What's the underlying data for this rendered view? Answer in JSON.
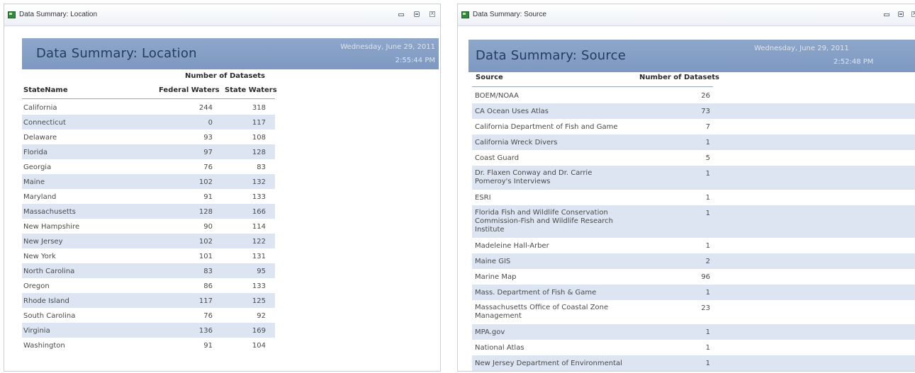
{
  "location_window": {
    "title": "Data Summary: Location",
    "report_title": "Data Summary: Location",
    "date": "Wednesday, June 29, 2011",
    "time": "2:55:44 PM",
    "group_header": "Number of Datasets",
    "columns": [
      "StateName",
      "Federal Waters",
      "State Waters"
    ],
    "rows": [
      {
        "state": "California",
        "federal": "244",
        "state_waters": "318"
      },
      {
        "state": "Connecticut",
        "federal": "0",
        "state_waters": "117"
      },
      {
        "state": "Delaware",
        "federal": "93",
        "state_waters": "108"
      },
      {
        "state": "Florida",
        "federal": "97",
        "state_waters": "128"
      },
      {
        "state": "Georgia",
        "federal": "76",
        "state_waters": "83"
      },
      {
        "state": "Maine",
        "federal": "102",
        "state_waters": "132"
      },
      {
        "state": "Maryland",
        "federal": "91",
        "state_waters": "133"
      },
      {
        "state": "Massachusetts",
        "federal": "128",
        "state_waters": "166"
      },
      {
        "state": "New Hampshire",
        "federal": "90",
        "state_waters": "114"
      },
      {
        "state": "New Jersey",
        "federal": "102",
        "state_waters": "122"
      },
      {
        "state": "New York",
        "federal": "101",
        "state_waters": "131"
      },
      {
        "state": "North Carolina",
        "federal": "83",
        "state_waters": "95"
      },
      {
        "state": "Oregon",
        "federal": "86",
        "state_waters": "133"
      },
      {
        "state": "Rhode Island",
        "federal": "117",
        "state_waters": "125"
      },
      {
        "state": "South Carolina",
        "federal": "76",
        "state_waters": "92"
      },
      {
        "state": "Virginia",
        "federal": "136",
        "state_waters": "169"
      },
      {
        "state": "Washington",
        "federal": "91",
        "state_waters": "104"
      }
    ]
  },
  "source_window": {
    "title": "Data Summary: Source",
    "report_title": "Data Summary: Source",
    "date": "Wednesday, June 29, 2011",
    "time": "2:52:48 PM",
    "columns": [
      "Source",
      "Number of Datasets"
    ],
    "rows": [
      {
        "source": "BOEM/NOAA",
        "count": "26"
      },
      {
        "source": "CA Ocean Uses Atlas",
        "count": "73"
      },
      {
        "source": "California Department of Fish and Game",
        "count": "7"
      },
      {
        "source": "California Wreck Divers",
        "count": "1"
      },
      {
        "source": "Coast Guard",
        "count": "5"
      },
      {
        "source": "Dr. Flaxen Conway and Dr. Carrie Pomeroy's Interviews",
        "count": "1"
      },
      {
        "source": "ESRI",
        "count": "1"
      },
      {
        "source": "Florida Fish and Wildlife Conservation Commission-Fish and Wildlife Research Institute",
        "count": "1"
      },
      {
        "source": "Madeleine Hall-Arber",
        "count": "1"
      },
      {
        "source": "Maine GIS",
        "count": "2"
      },
      {
        "source": "Marine Map",
        "count": "96"
      },
      {
        "source": "Mass. Department of Fish & Game",
        "count": "1"
      },
      {
        "source": "Massachusetts Office of Coastal Zone Management",
        "count": "23"
      },
      {
        "source": "MPA.gov",
        "count": "1"
      },
      {
        "source": "National Atlas",
        "count": "1"
      },
      {
        "source": "New Jersey Department of Environmental",
        "count": "1"
      }
    ]
  },
  "icons": {
    "app": "access-report-icon",
    "minimize": "minimize-icon",
    "maximize": "maximize-icon",
    "close": "close-icon"
  },
  "colors": {
    "banner": "#7d98c1",
    "alt_row": "#dce5f1",
    "title_text": "#253b5f"
  }
}
